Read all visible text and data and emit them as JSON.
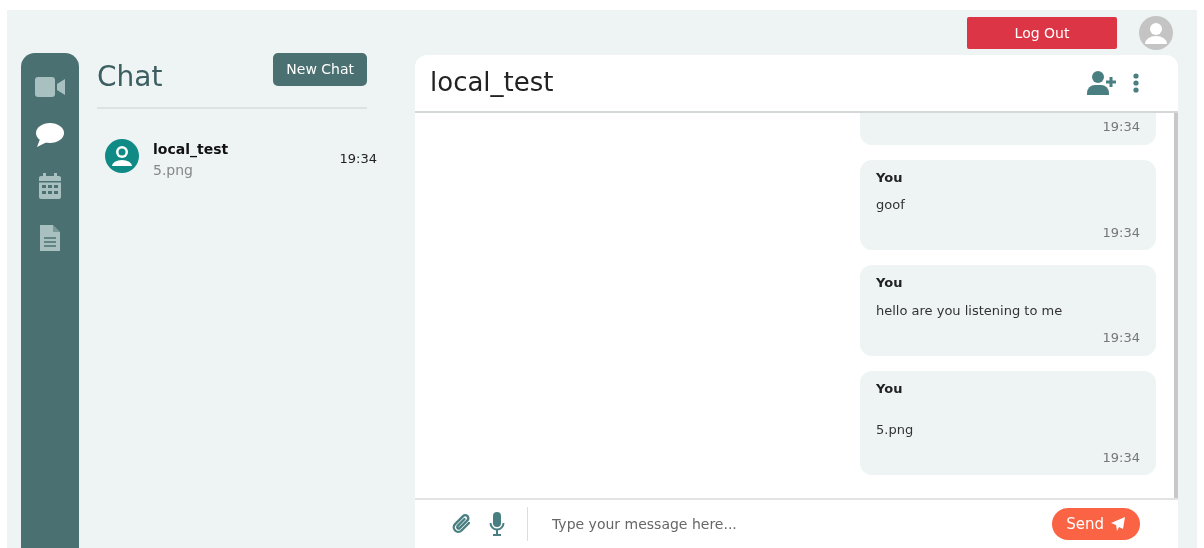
{
  "top_bar": {
    "logout_button": "Log Out"
  },
  "nav": [
    {
      "kind": "video",
      "selected": false
    },
    {
      "kind": "chat",
      "selected": true
    },
    {
      "kind": "calendar",
      "selected": false
    },
    {
      "kind": "document",
      "selected": false
    }
  ],
  "chat_list": {
    "title": "Chat",
    "new_chat_button": "New Chat",
    "items": [
      {
        "name": "local_test",
        "last_message": "5.png",
        "time": "19:34",
        "selected": true
      }
    ]
  },
  "conversation": {
    "title": "local_test",
    "messages": [
      {
        "kind": "cut",
        "time": "19:34"
      },
      {
        "kind": "text",
        "sender": "You",
        "text": "goof",
        "time": "19:34"
      },
      {
        "kind": "text",
        "sender": "You",
        "text": "hello are you listening to me",
        "time": "19:34"
      },
      {
        "kind": "file",
        "sender": "You",
        "text": "5.png",
        "time": "19:34"
      }
    ],
    "composer": {
      "placeholder": "Type your message here...",
      "send_button": "Send"
    }
  }
}
